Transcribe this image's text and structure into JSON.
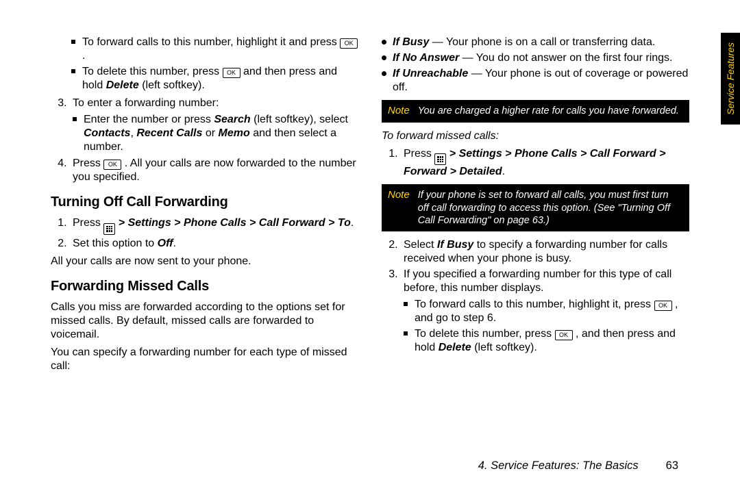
{
  "tab_label": "Service Features",
  "footer": {
    "chapter": "4. Service Features: The Basics",
    "page": "63"
  },
  "icons": {
    "ok": "OK"
  },
  "col1": {
    "sub_a": {
      "i1_pre": "To forward calls to this number, highlight it and press ",
      "i2_pre": "To delete this number, press ",
      "i2_mid": " and then press and hold ",
      "i2_delete": "Delete",
      "i2_post": " (left softkey)."
    },
    "step3": "To enter a forwarding number:",
    "sub_b": {
      "pre": "Enter the number or press ",
      "search": "Search",
      "mid1": " (left softkey), select ",
      "contacts": "Contacts",
      "sep1": ", ",
      "recent": "Recent Calls",
      "sep2": " or ",
      "memo": "Memo",
      "post": " and then select a number."
    },
    "step4_pre": "Press ",
    "step4_post": ". All your calls are now forwarded to the number you specified.",
    "h_off": "Turning Off Call Forwarding",
    "off_step1_pre": "Press ",
    "off_step1_mid": " > ",
    "off_step1_path": "Settings > Phone Calls > Call Forward > To",
    "off_step2_pre": "Set this option to ",
    "off_step2_off": "Off",
    "off_result": "All your calls are now sent to your phone.",
    "h_missed": "Forwarding Missed Calls",
    "missed_p1": "Calls you miss are forwarded according to the options set for missed calls. By default, missed calls are forwarded to voicemail.",
    "missed_p2": "You can specify a forwarding number for each type of missed call:"
  },
  "col2": {
    "opts": {
      "busy_l": "If Busy",
      "busy_t": " — Your phone is on a call or transferring data.",
      "noans_l": "If No Answer",
      "noans_t": " — You do not answer on the first four rings.",
      "unreach_l": "If Unreachable",
      "unreach_t": " — Your phone is out of coverage or powered off."
    },
    "note1_label": "Note",
    "note1_text": "You are charged a higher rate for calls you have forwarded.",
    "sub_head": "To forward missed calls:",
    "s1_pre": "Press ",
    "s1_mid": " > ",
    "s1_path": "Settings > Phone Calls > Call Forward > Forward > Detailed",
    "note2_label": "Note",
    "note2_text": "If your phone is set to forward all calls, you must first turn off call forwarding to access this option. (See \"Turning Off Call Forwarding\" on page 63.)",
    "s2_pre": "Select ",
    "s2_ifbusy": "If Busy",
    "s2_post": " to specify a forwarding number for calls received when your phone is busy.",
    "s3": "If you specified a forwarding number for this type of call before, this number displays.",
    "sub_c": {
      "i1_pre": "To forward calls to this number, highlight it, press ",
      "i1_post": ", and go to step 6.",
      "i2_pre": "To delete this number, press ",
      "i2_mid": ", and then press and hold ",
      "i2_delete": "Delete",
      "i2_post": " (left softkey)."
    }
  }
}
